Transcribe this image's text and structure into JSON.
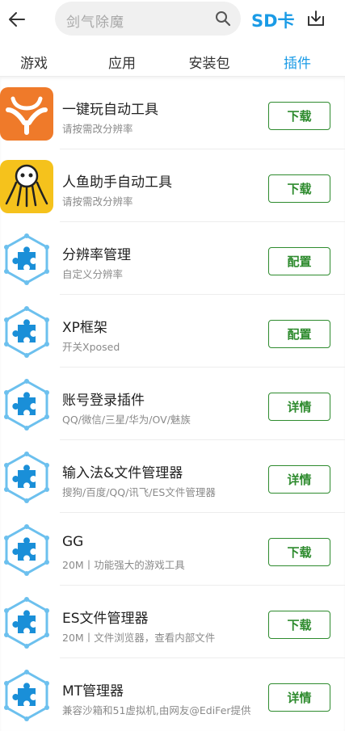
{
  "header": {
    "search_placeholder": "剑气除魔",
    "sd_label": "SD卡"
  },
  "tabs": [
    {
      "label": "游戏",
      "active": false
    },
    {
      "label": "应用",
      "active": false
    },
    {
      "label": "安装包",
      "active": false
    },
    {
      "label": "插件",
      "active": true
    }
  ],
  "colors": {
    "accent": "#1a9be6",
    "button_green": "#2e8b2e",
    "icon_orange": "#ef7a2a",
    "icon_yellow": "#f5c21c",
    "puzzle_blue": "#1a8fd8"
  },
  "items": [
    {
      "name": "一键玩自动工具",
      "desc": "请按需改分辨率",
      "button": "下载",
      "icon": "orange-y-logo-icon"
    },
    {
      "name": "人鱼助手自动工具",
      "desc": "请按需改分辨率",
      "button": "下载",
      "icon": "mermaid-logo-icon"
    },
    {
      "name": "分辨率管理",
      "desc": "自定义分辨率",
      "button": "配置",
      "icon": "puzzle-icon"
    },
    {
      "name": "XP框架",
      "desc": "开关Xposed",
      "button": "配置",
      "icon": "puzzle-icon"
    },
    {
      "name": "账号登录插件",
      "desc": "QQ/微信/三星/华为/OV/魅族",
      "button": "详情",
      "icon": "puzzle-icon"
    },
    {
      "name": "输入法&文件管理器",
      "desc": "搜狗/百度/QQ/讯飞/ES文件管理器",
      "button": "详情",
      "icon": "puzzle-icon"
    },
    {
      "name": "GG",
      "desc": "20M丨功能强大的游戏工具",
      "button": "下载",
      "icon": "puzzle-icon"
    },
    {
      "name": "ES文件管理器",
      "desc": "20M丨文件浏览器，查看内部文件",
      "button": "下载",
      "icon": "puzzle-icon"
    },
    {
      "name": "MT管理器",
      "desc": "兼容沙箱和51虚拟机,由网友@EdiFer提供",
      "button": "详情",
      "icon": "puzzle-icon"
    }
  ]
}
